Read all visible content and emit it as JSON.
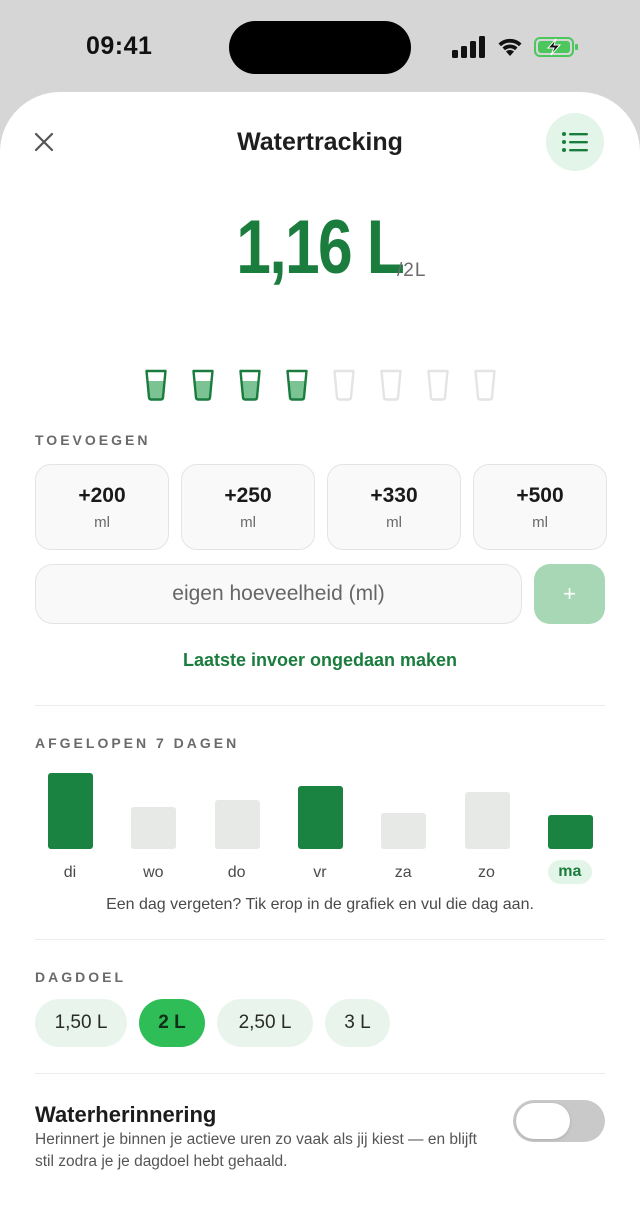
{
  "status_bar": {
    "time": "09:41",
    "icons": [
      "signal-icon",
      "wifi-icon",
      "battery-charging-icon"
    ]
  },
  "header": {
    "title": "Watertracking",
    "close_icon": "close-icon",
    "menu_icon": "list-icon"
  },
  "intake": {
    "value": "1,16 L",
    "goal": "/2L"
  },
  "glasses": {
    "total": 8,
    "filled": 4
  },
  "add_section": {
    "label": "TOEVOEGEN",
    "quick_amounts": [
      {
        "amount": "+200",
        "unit": "ml"
      },
      {
        "amount": "+250",
        "unit": "ml"
      },
      {
        "amount": "+330",
        "unit": "ml"
      },
      {
        "amount": "+500",
        "unit": "ml"
      }
    ],
    "custom_placeholder": "eigen hoeveelheid (ml)",
    "add_label": "+",
    "undo_label": "Laatste invoer ongedaan maken"
  },
  "history": {
    "label": "AFGELOPEN 7 DAGEN",
    "hint": "Een dag vergeten? Tik erop in de grafiek en vul die dag aan."
  },
  "chart_data": {
    "type": "bar",
    "categories": [
      "di",
      "wo",
      "do",
      "vr",
      "za",
      "zo",
      "ma"
    ],
    "values": [
      2.0,
      1.1,
      1.3,
      1.65,
      0.95,
      1.5,
      0.9
    ],
    "goal_met": [
      true,
      false,
      false,
      true,
      false,
      false,
      true
    ],
    "active_day": "ma",
    "colors": {
      "met": "#1a8341",
      "unmet": "#e6e9e6"
    }
  },
  "daily_goal": {
    "label": "DAGDOEL",
    "options": [
      "1,50 L",
      "2 L",
      "2,50 L",
      "3 L"
    ],
    "selected": "2 L"
  },
  "reminder": {
    "title": "Waterherinnering",
    "description": "Herinnert je binnen je actieve uren zo vaak als jij kiest — en blijft stil zodra je je dagdoel hebt gehaald.",
    "enabled": false
  },
  "colors": {
    "accent": "#1a7d3e",
    "accent_light": "#e3f4e8",
    "selected_chip": "#2fbd57"
  }
}
